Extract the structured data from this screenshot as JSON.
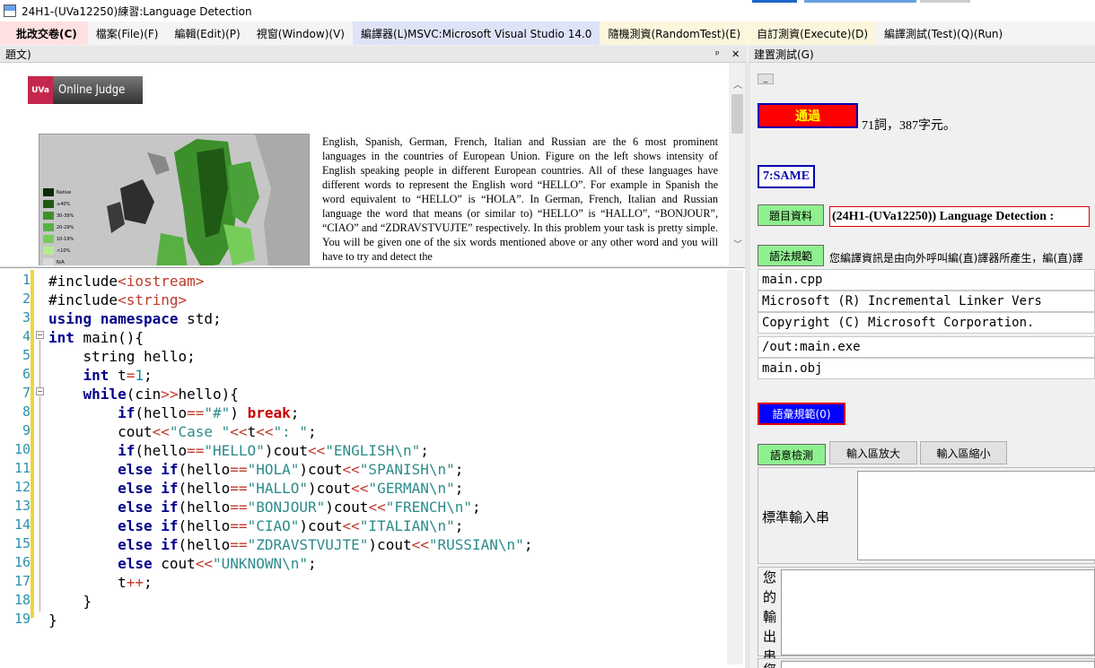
{
  "window": {
    "title": "24H1-(UVa12250)練習:Language Detection"
  },
  "menu": [
    "批改交卷(C)",
    "檔案(File)(F)",
    "編輯(Edit)(P)",
    "視窗(Window)(V)",
    "編譯器(L)MSVC:Microsoft Visual Studio 14.0",
    "隨機測資(RandomTest)(E)",
    "自訂測資(Execute)(D)",
    "編譯測試(Test)(Q)(Run)"
  ],
  "left_pane": {
    "header": "題文)",
    "pin": "ᵖ",
    "close": "✕"
  },
  "right_pane": {
    "header": "建置測試(G)"
  },
  "doc": {
    "logo_badge": "UVa",
    "logo_text": "Online Judge",
    "paragraph": "English, Spanish, German, French, Italian and Russian are the 6 most prominent languages in the countries of European Union. Figure on the left shows intensity of English speaking people in different European countries. All of these languages have different words to represent the English word “HELLO”. For example in Spanish the word equivalent to “HELLO” is “HOLA”. In German, French, Italian and Russian language the word that means (or similar to) “HELLO” is “HALLO”, “BONJOUR”, “CIAO” and “ZDRAVSTVUJTE” respectively. In this problem your task is pretty simple. You will be given one of the six words mentioned above or any other word and you will have to try and detect the",
    "map_legend": [
      "Native",
      "≥40%",
      "30-39%",
      "20-29%",
      "10-19%",
      "<10%",
      "N/A"
    ]
  },
  "editor": {
    "lines": [
      "1",
      "2",
      "3",
      "4",
      "5",
      "6",
      "7",
      "8",
      "9",
      "10",
      "11",
      "12",
      "13",
      "14",
      "15",
      "16",
      "17",
      "18",
      "19"
    ]
  },
  "right": {
    "small_btn": "_",
    "pass_label": "通過",
    "stats": "71詞，387字元。",
    "same": "7:SAME",
    "topic_btn": "題目資料",
    "topic_text": "(24H1-(UVa12250)) Language Detection :",
    "grammar_btn": "語法規範",
    "grammar_text": "您編譯資訊是由向外呼叫編(直)譯器所產生，編(直)譯",
    "output_lines": [
      "main.cpp",
      "Microsoft (R) Incremental Linker Vers",
      "Copyright (C) Microsoft Corporation.",
      "/out:main.exe",
      "main.obj"
    ],
    "vocab_btn": "語彙規範(0)",
    "semantic_btn": "語意檢測",
    "zoom_in_btn": "輸入區放大",
    "zoom_out_btn": "輸入區縮小",
    "std_input_label": "標準輸入串",
    "your_output_label": "您的輸出串",
    "your_label2": "您"
  },
  "colors": {
    "pass_bg": "#ff0000",
    "pass_text": "#ffff00",
    "vocab_bg": "#0000ff",
    "green_btn": "#8ff08f"
  }
}
